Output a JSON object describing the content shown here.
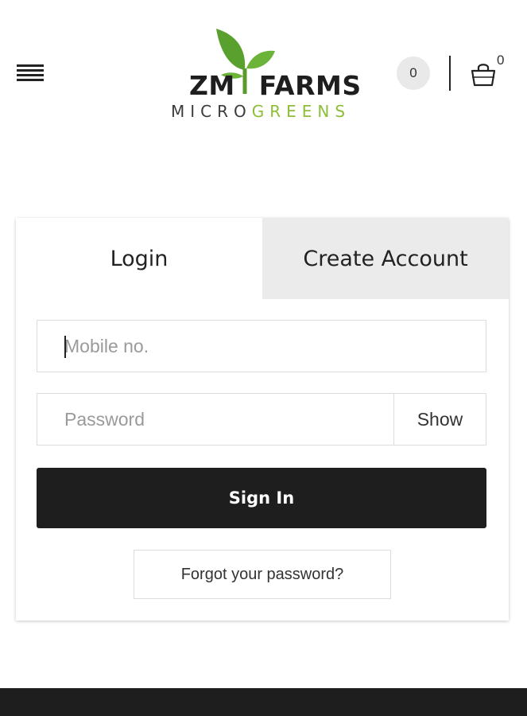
{
  "header": {
    "logo": {
      "title_part1": "ZM",
      "title_part2": "FARMS",
      "subtitle_part1": "MICRO",
      "subtitle_part2": "GREENS"
    },
    "counter_badge": "0",
    "cart_count": "0",
    "icons": {
      "menu": "hamburger-menu-icon",
      "cart": "shopping-bag-icon",
      "leaf": "leaf-icon"
    }
  },
  "auth": {
    "tabs": [
      {
        "label": "Login",
        "active": true
      },
      {
        "label": "Create Account",
        "active": false
      }
    ],
    "mobile_placeholder": "Mobile no.",
    "password_placeholder": "Password",
    "show_label": "Show",
    "signin_label": "Sign In",
    "forgot_label": "Forgot your password?"
  },
  "colors": {
    "brand_green": "#8cbe38",
    "dark": "#1e1e1e",
    "tab_inactive_bg": "#ebebeb"
  }
}
